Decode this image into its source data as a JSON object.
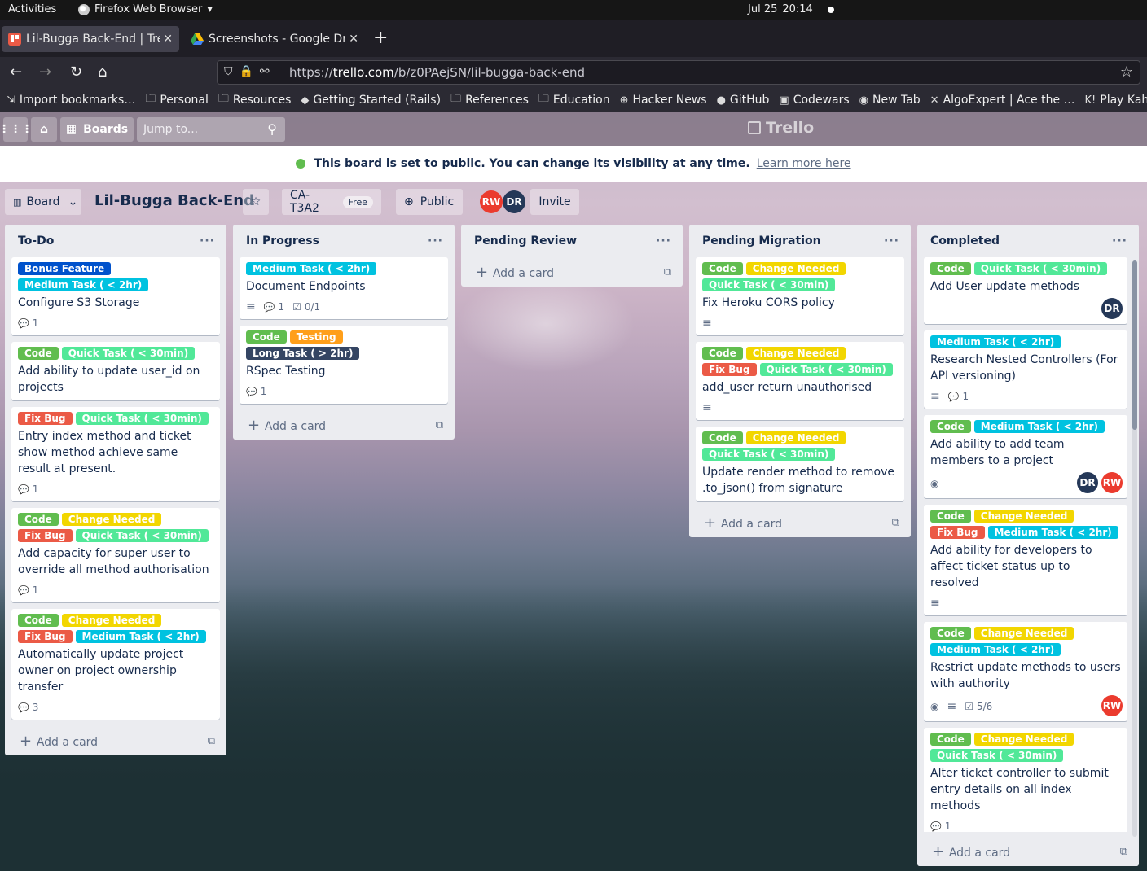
{
  "os": {
    "activities": "Activities",
    "app_name": "Firefox Web Browser",
    "date": "Jul 25",
    "time": "20:14"
  },
  "browser": {
    "tabs": [
      {
        "title": "Lil-Bugga Back-End | Trello",
        "active": true
      },
      {
        "title": "Screenshots - Google Drive",
        "active": false
      }
    ],
    "url_prefix": "https://",
    "url_domain": "trello.com",
    "url_path": "/b/z0PAejSN/lil-bugga-back-end",
    "bookmarks": [
      {
        "label": "Import bookmarks…",
        "icon": "import-icon"
      },
      {
        "label": "Personal",
        "icon": "folder-icon"
      },
      {
        "label": "Resources",
        "icon": "folder-icon"
      },
      {
        "label": "Getting Started (Rails)",
        "icon": "rails-icon"
      },
      {
        "label": "References",
        "icon": "folder-icon"
      },
      {
        "label": "Education",
        "icon": "folder-icon"
      },
      {
        "label": "Hacker News",
        "icon": "globe-icon"
      },
      {
        "label": "GitHub",
        "icon": "github-icon"
      },
      {
        "label": "Codewars",
        "icon": "codewars-icon"
      },
      {
        "label": "New Tab",
        "icon": "firefox-icon"
      },
      {
        "label": "AlgoExpert | Ace the …",
        "icon": "algoexpert-icon"
      },
      {
        "label": "Play Kah",
        "icon": "kahoot-icon"
      }
    ]
  },
  "trello": {
    "boards_label": "Boards",
    "search_placeholder": "Jump to...",
    "logo": "Trello",
    "banner_text": "This board is set to public. You can change its visibility at any time.",
    "banner_link": "Learn more here",
    "view_label": "Board",
    "board_title": "Lil-Bugga Back-End",
    "workspace": "CA-T3A2",
    "plan": "Free",
    "visibility": "Public",
    "invite": "Invite",
    "members": [
      "RW",
      "DR"
    ],
    "add_card": "Add a card"
  },
  "label_colors": {
    "Bonus Feature": "#0052cc",
    "Medium Task ( < 2hr)": "#00c2e0",
    "Quick Task ( < 30min)": "#51e898",
    "Code": "#61bd4f",
    "Testing": "#ff9f1a",
    "Long Task ( > 2hr)": "#344563",
    "Change Needed": "#f2d600",
    "Fix Bug": "#eb5a46"
  },
  "lists": [
    {
      "name": "To-Do",
      "cards": [
        {
          "labels": [
            "Bonus Feature",
            "Medium Task ( < 2hr)"
          ],
          "title": "Configure S3 Storage",
          "comments": "1"
        },
        {
          "labels": [
            "Code",
            "Quick Task ( < 30min)"
          ],
          "title": "Add ability to update user_id on projects"
        },
        {
          "labels": [
            "Fix Bug",
            "Quick Task ( < 30min)"
          ],
          "title": "Entry index method and ticket show method achieve same result at present.",
          "comments": "1"
        },
        {
          "labels": [
            "Code",
            "Change Needed",
            "Fix Bug",
            "Quick Task ( < 30min)"
          ],
          "title": "Add capacity for super user to override all method authorisation",
          "comments": "1"
        },
        {
          "labels": [
            "Code",
            "Change Needed",
            "Fix Bug",
            "Medium Task ( < 2hr)"
          ],
          "title": "Automatically update project owner on project ownership transfer",
          "comments": "3"
        }
      ]
    },
    {
      "name": "In Progress",
      "cards": [
        {
          "labels": [
            "Medium Task ( < 2hr)"
          ],
          "title": "Document Endpoints",
          "description": true,
          "comments": "1",
          "checklist": "0/1"
        },
        {
          "labels": [
            "Code",
            "Testing",
            "Long Task ( > 2hr)"
          ],
          "title": "RSpec Testing",
          "comments": "1"
        }
      ]
    },
    {
      "name": "Pending Review",
      "cards": []
    },
    {
      "name": "Pending Migration",
      "cards": [
        {
          "labels": [
            "Code",
            "Change Needed",
            "Quick Task ( < 30min)"
          ],
          "title": "Fix Heroku CORS policy",
          "description": true
        },
        {
          "labels": [
            "Code",
            "Change Needed",
            "Fix Bug",
            "Quick Task ( < 30min)"
          ],
          "title": "add_user return unauthorised",
          "description": true
        },
        {
          "labels": [
            "Code",
            "Change Needed",
            "Quick Task ( < 30min)"
          ],
          "title": "Update render method to remove .to_json() from signature"
        }
      ]
    },
    {
      "name": "Completed",
      "cards": [
        {
          "labels": [
            "Code",
            "Quick Task ( < 30min)"
          ],
          "title": "Add User update methods",
          "members": [
            "DR"
          ]
        },
        {
          "labels": [
            "Medium Task ( < 2hr)"
          ],
          "title": "Research Nested Controllers (For API versioning)",
          "description": true,
          "comments": "1"
        },
        {
          "labels": [
            "Code",
            "Medium Task ( < 2hr)"
          ],
          "title": "Add ability to add team members to a project",
          "watching": true,
          "members": [
            "DR",
            "RW"
          ]
        },
        {
          "labels": [
            "Code",
            "Change Needed",
            "Fix Bug",
            "Medium Task ( < 2hr)"
          ],
          "title": "Add ability for developers to affect ticket status up to resolved",
          "description": true
        },
        {
          "labels": [
            "Code",
            "Change Needed",
            "Medium Task ( < 2hr)"
          ],
          "title": "Restrict update methods to users with authority",
          "watching": true,
          "description": true,
          "checklist": "5/6",
          "members": [
            "RW"
          ]
        },
        {
          "labels": [
            "Code",
            "Change Needed",
            "Quick Task ( < 30min)"
          ],
          "title": "Alter ticket controller to submit entry details on all index methods",
          "comments": "1"
        }
      ]
    }
  ]
}
